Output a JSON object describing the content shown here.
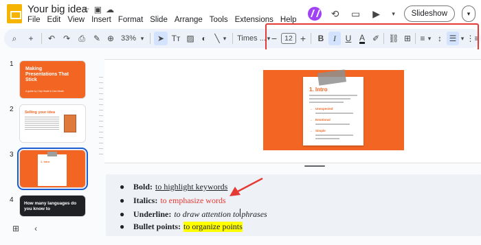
{
  "header": {
    "title": "Your big idea",
    "menus": [
      "File",
      "Edit",
      "View",
      "Insert",
      "Format",
      "Slide",
      "Arrange",
      "Tools",
      "Extensions",
      "Help"
    ],
    "slideshow_label": "Slideshow"
  },
  "toolbar": {
    "zoom": "33%",
    "font": "Times ...",
    "font_size": "12"
  },
  "thumbnails": [
    {
      "num": "1",
      "title": "Making Presentations That Stick",
      "sub": "A guide by Chip Heath & Dan Heath"
    },
    {
      "num": "2",
      "title": "Selling your idea"
    },
    {
      "num": "3",
      "title": "1. Intro"
    },
    {
      "num": "4",
      "title": "How many languages do you know to"
    }
  ],
  "slide": {
    "title": "1. Intro",
    "items": [
      "Unexpected",
      "Emotional",
      "Simple"
    ]
  },
  "notes": [
    {
      "label": "Bold:",
      "text": "to highlight keywords"
    },
    {
      "label": "Italics:",
      "text": "to emphasize words"
    },
    {
      "label": "Underline:",
      "text_a": "to draw attention to",
      "text_b": "phrases"
    },
    {
      "label": "Bullet points:",
      "text": "to organize points"
    }
  ],
  "colors": {
    "accent": "#f26522",
    "highlight_box": "#e53935",
    "selection": "#d3e3fd"
  }
}
